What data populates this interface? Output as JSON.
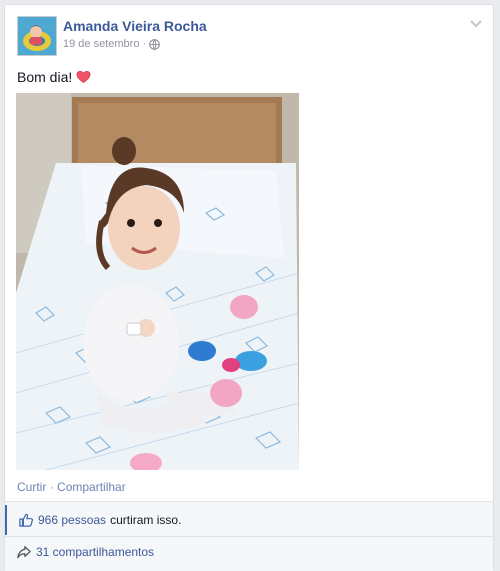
{
  "post": {
    "author": "Amanda Vieira Rocha",
    "date": "19 de setembro",
    "meta_separator": "·",
    "status_text": "Bom dia!",
    "photo_icon": "baby-photo",
    "chevron_icon": "chevron-down-icon",
    "privacy_icon": "globe-icon",
    "heart_icon": "heart-icon"
  },
  "actions": {
    "like": "Curtir",
    "separator": "·",
    "share": "Compartilhar"
  },
  "ufi": {
    "likes_count_text": "966 pessoas",
    "likes_suffix": "curtiram isso.",
    "shares_text": "31 compartilhamentos",
    "like_icon": "thumbs-up-icon",
    "share_icon": "share-arrow-icon"
  },
  "colors": {
    "link": "#3b5998",
    "meta": "#90949c",
    "heart": "#f25268",
    "background": "#e9ebee"
  }
}
